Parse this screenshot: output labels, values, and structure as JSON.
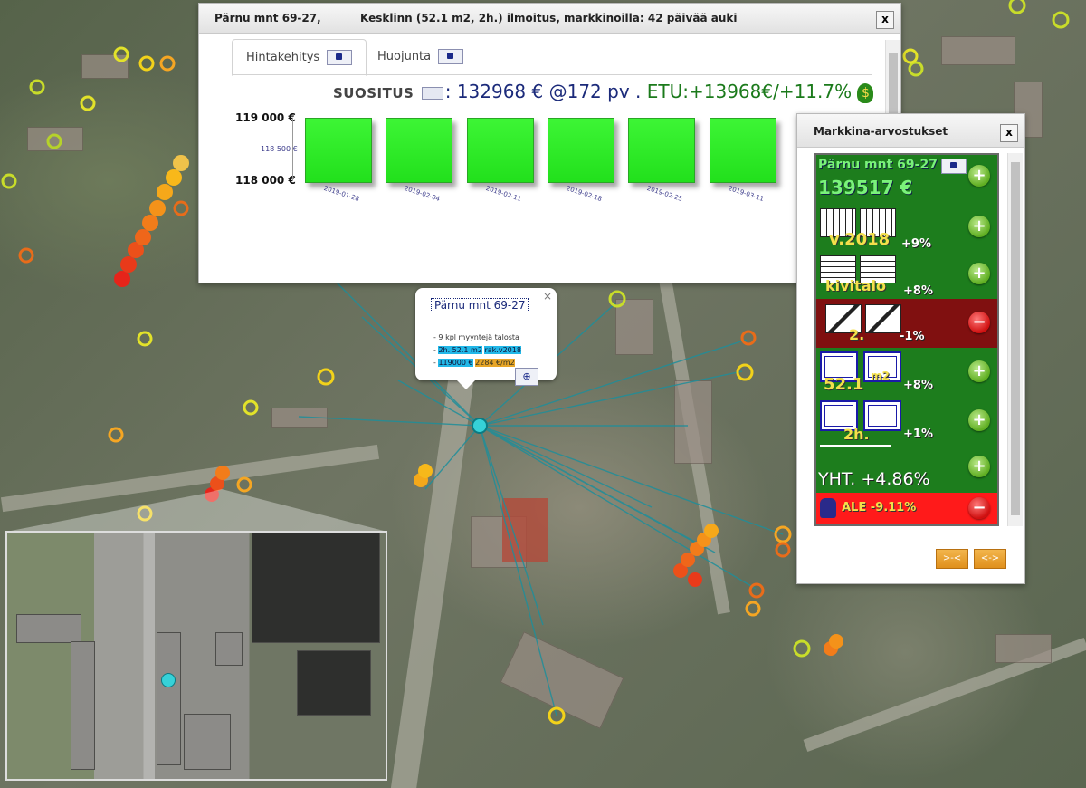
{
  "main_dialog": {
    "title_address": "Pärnu mnt 69-27,",
    "title_info": "Kesklinn (52.1 m2, 2h.) ilmoitus, markkinoilla: 42 päivää auki",
    "close_label": "x",
    "tabs": [
      {
        "label": "Hintakehitys",
        "active": true
      },
      {
        "label": "Huojunta",
        "active": false
      }
    ],
    "recommendation": {
      "label": "SUOSITUS",
      "colon": ":",
      "value": "132968 € @172 pv",
      "sep": " . ",
      "etu": "ETU:+13968€/+11.7%"
    }
  },
  "chart_data": {
    "type": "bar",
    "categories": [
      "2019-01-28",
      "2019-02-04",
      "2019-02-11",
      "2019-02-18",
      "2019-02-25",
      "2019-03-11"
    ],
    "values": [
      119000,
      119000,
      119000,
      119000,
      119000,
      119000
    ],
    "ylim": [
      118000,
      119000
    ],
    "yticks": [
      "119 000 €",
      "118 500 €",
      "118 000 €"
    ],
    "bar_color": "#22e01c",
    "title": "",
    "xlabel": "",
    "ylabel": ""
  },
  "popup": {
    "title": "Pärnu mnt 69-27",
    "close": "×",
    "line1": "- 9 kpl myyntejä talosta",
    "line2_prefix": "- ",
    "line2_a": "2h. 52.1 m2",
    "line2_b": "rak.v2018",
    "line3_prefix": "- ",
    "line3_a": "119000 €",
    "line3_b": "2284 €/m2",
    "zoom_icon": "zoom-in-icon"
  },
  "side_dialog": {
    "title": "Markkina-arvostukset",
    "close_label": "x",
    "address": "Pärnu mnt 69-27",
    "price": "139517 €",
    "factors": [
      {
        "label": "v.2018",
        "pct": "+9%",
        "icon": "calendar-icon",
        "sign": "+"
      },
      {
        "label": "kivitalo",
        "pct": "+8%",
        "icon": "brick-icon",
        "sign": "+"
      },
      {
        "label": "2.",
        "pct": "-1%",
        "icon": "floor-icon",
        "sign": "-"
      },
      {
        "label": "52.1",
        "unit": "m2",
        "pct": "+8%",
        "icon": "floorplan-icon",
        "sign": "+"
      },
      {
        "label": "2h.",
        "pct": "+1%",
        "icon": "rooms-icon",
        "sign": "+"
      }
    ],
    "total": "YHT. +4.86%",
    "discount": "ALE -9.11%",
    "btn_collapse": ">-<",
    "btn_expand": "<->"
  },
  "colors": {
    "green_panel": "#1d7d1d",
    "red_panel": "#801010",
    "alert_red": "#ff1a1a",
    "text_yellow": "#f4e04b",
    "accent_blue": "#1b2a7a"
  }
}
